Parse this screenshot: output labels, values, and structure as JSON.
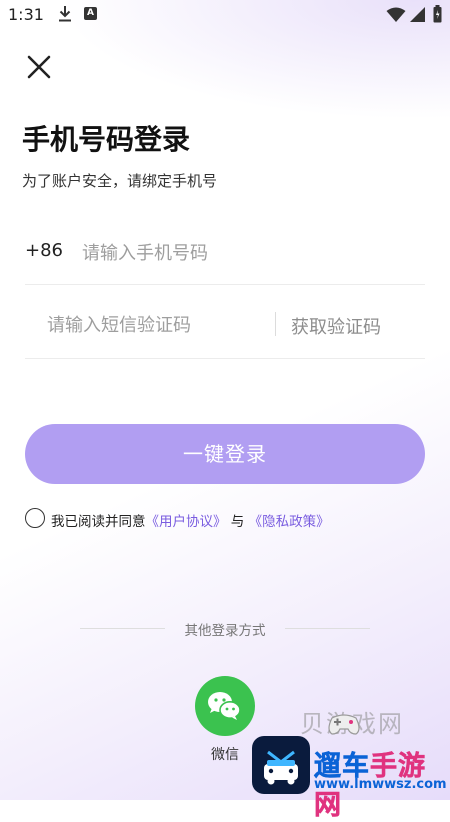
{
  "status_bar": {
    "time": "1:31",
    "notif_letter": "A"
  },
  "header": {
    "title": "手机号码登录",
    "subtitle": "为了账户安全，请绑定手机号"
  },
  "phone": {
    "country_code": "+86",
    "placeholder": "请输入手机号码",
    "value": ""
  },
  "code": {
    "placeholder": "请输入短信验证码",
    "value": "",
    "get_code_label": "获取验证码"
  },
  "login_button_label": "一键登录",
  "agreement": {
    "checked": false,
    "prefix": "我已阅读并同意",
    "user_agreement": "《用户协议》",
    "joiner": "与",
    "privacy_policy": "《隐私政策》"
  },
  "other_login": {
    "label": "其他登录方式",
    "wechat_label": "微信"
  },
  "watermark": {
    "ghost_text": "贝游戏网",
    "brand_text_1": "遛车",
    "brand_text_2": "手游网",
    "url": "www.lmwwsz.com"
  },
  "colors": {
    "accent": "#b19ef2",
    "link": "#7a5de0",
    "wechat": "#3bc24f"
  },
  "icons": {
    "close": "close-icon",
    "wechat": "wechat-icon",
    "download": "download-icon",
    "wifi": "wifi-icon",
    "signal": "signal-icon",
    "battery": "battery-icon"
  }
}
